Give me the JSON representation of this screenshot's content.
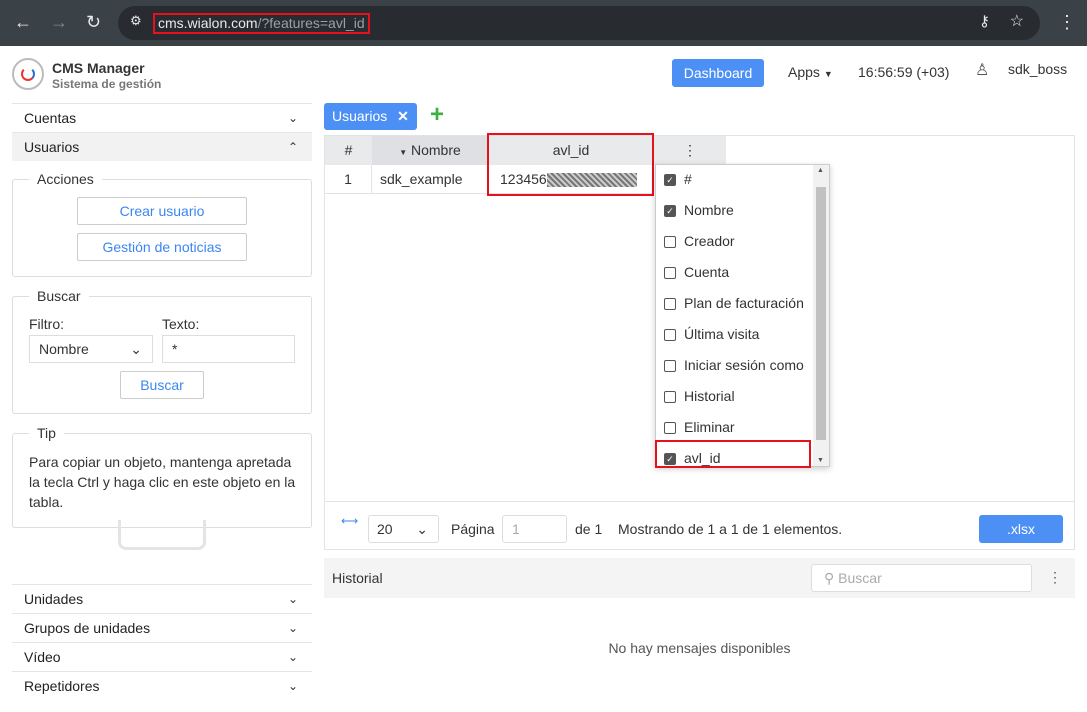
{
  "browser": {
    "url_host": "cms.wialon.com",
    "url_path": "/?features=avl_id"
  },
  "header": {
    "title": "CMS Manager",
    "subtitle": "Sistema de gestión",
    "dashboard": "Dashboard",
    "apps": "Apps",
    "time": "16:56:59 (+03)",
    "user": "sdk_boss"
  },
  "sidebar": {
    "cuentas": "Cuentas",
    "usuarios": "Usuarios",
    "acciones": {
      "legend": "Acciones",
      "crear": "Crear usuario",
      "noticias": "Gestión de noticias"
    },
    "buscar": {
      "legend": "Buscar",
      "filtro_label": "Filtro:",
      "texto_label": "Texto:",
      "filtro": "Nombre",
      "texto": "*",
      "button": "Buscar"
    },
    "tip": {
      "legend": "Tip",
      "text": "Para copiar un objeto, mantenga apretada la tecla Ctrl y haga clic en este objeto en la tabla."
    },
    "bottom": [
      "Unidades",
      "Grupos de unidades",
      "Vídeo",
      "Repetidores"
    ]
  },
  "main": {
    "tab": "Usuarios",
    "columns": [
      "#",
      "Nombre",
      "avl_id"
    ],
    "rows": [
      {
        "n": "1",
        "nombre": "sdk_example",
        "avl_id": "123456"
      }
    ],
    "column_menu": [
      {
        "label": "#",
        "checked": true
      },
      {
        "label": "Nombre",
        "checked": true
      },
      {
        "label": "Creador",
        "checked": false
      },
      {
        "label": "Cuenta",
        "checked": false
      },
      {
        "label": "Plan de facturación",
        "checked": false
      },
      {
        "label": "Última visita",
        "checked": false
      },
      {
        "label": "Iniciar sesión como",
        "checked": false
      },
      {
        "label": "Historial",
        "checked": false
      },
      {
        "label": "Eliminar",
        "checked": false
      },
      {
        "label": "avl_id",
        "checked": true
      }
    ],
    "pager": {
      "per_page": "20",
      "page_label": "Página",
      "page": "1",
      "of": "de 1",
      "showing": "Mostrando de 1 a 1 de 1 elementos.",
      "export": ".xlsx"
    },
    "history": {
      "title": "Historial",
      "search_placeholder": "Buscar",
      "empty": "No hay mensajes disponibles"
    }
  }
}
